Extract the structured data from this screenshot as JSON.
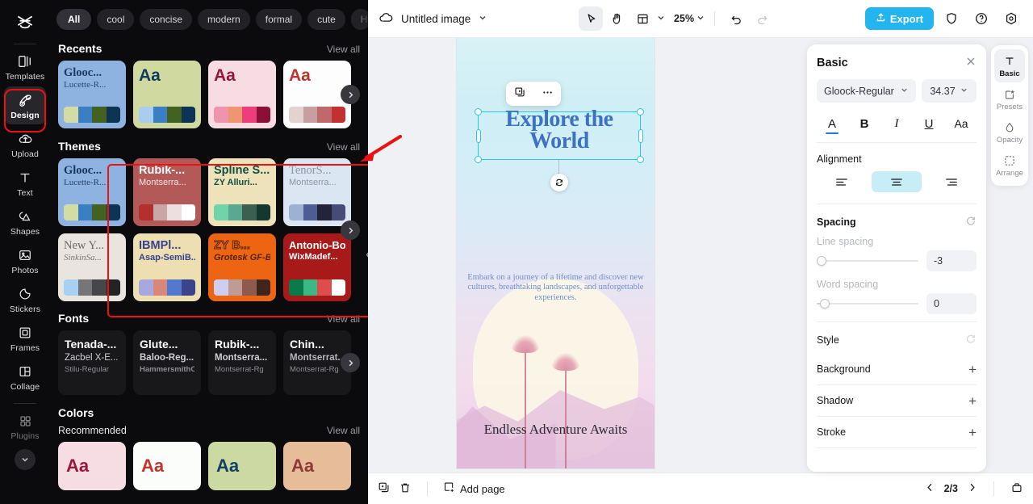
{
  "rail": {
    "logo_icon": "capcut-logo-icon",
    "items": [
      {
        "label": "Templates",
        "icon": "templates-icon",
        "active": false
      },
      {
        "label": "Design",
        "icon": "design-icon",
        "active": true
      },
      {
        "label": "Upload",
        "icon": "upload-cloud-icon",
        "active": false
      },
      {
        "label": "Text",
        "icon": "text-icon",
        "active": false
      },
      {
        "label": "Shapes",
        "icon": "shapes-icon",
        "active": false
      },
      {
        "label": "Photos",
        "icon": "photos-icon",
        "active": false
      },
      {
        "label": "Stickers",
        "icon": "stickers-icon",
        "active": false
      },
      {
        "label": "Frames",
        "icon": "frames-icon",
        "active": false
      },
      {
        "label": "Collage",
        "icon": "collage-icon",
        "active": false
      },
      {
        "label": "Plugins",
        "icon": "plugins-icon",
        "active": false
      }
    ],
    "expand_icon": "chevron-down-icon"
  },
  "panel": {
    "chips": [
      {
        "label": "All",
        "selected": true
      },
      {
        "label": "cool",
        "selected": false
      },
      {
        "label": "concise",
        "selected": false
      },
      {
        "label": "modern",
        "selected": false
      },
      {
        "label": "formal",
        "selected": false
      },
      {
        "label": "cute",
        "selected": false
      },
      {
        "label": "Holiday",
        "selected": false
      }
    ],
    "chip_more_icon": "chevron-down-icon",
    "view_all": "View all",
    "sections": {
      "recents": {
        "title": "Recents",
        "cards": [
          {
            "line1": "Glooc...",
            "line2": "Lucette-R...",
            "aa": "",
            "bg": "#8fb3e0",
            "c1": "#1d3a63",
            "c2": "#2a4a72",
            "swatch": [
              "#d4dba3",
              "#3a7fc4",
              "#44621f",
              "#0e3455"
            ]
          },
          {
            "line1": "",
            "line2": "",
            "aa": "Aa",
            "bg": "#cfd9a0",
            "c1": "#123a5c",
            "c2": "#123a5c",
            "swatch": [
              "#a9cdec",
              "#3a7fc4",
              "#44621f",
              "#0e3455"
            ]
          },
          {
            "line1": "",
            "line2": "",
            "aa": "Aa",
            "bg": "#f7dde3",
            "c1": "#9b1539",
            "c2": "#9b1539",
            "swatch": [
              "#f093ac",
              "#ee9571",
              "#ec3d7c",
              "#8c0f38"
            ]
          },
          {
            "line1": "",
            "line2": "",
            "aa": "Aa",
            "bg": "#fdfdfd",
            "c1": "#c0342f",
            "c2": "#c0342f",
            "swatch": [
              "#e4d2d1",
              "#c6a0a0",
              "#c0696a",
              "#c2302f"
            ]
          }
        ]
      },
      "themes": {
        "title": "Themes",
        "cards": [
          {
            "line1": "Glooc...",
            "line2": "Lucette-R...",
            "bg": "#8fb3e0",
            "c1": "#17365e",
            "c2": "#25446e",
            "swatch": [
              "#d4dba3",
              "#3a7fc4",
              "#44621f",
              "#0e3455"
            ]
          },
          {
            "line1": "Rubik-...",
            "line2": "Montserra...",
            "bg": "#b35a58",
            "c1": "#ffffff",
            "c2": "#f6e3e3",
            "swatch": [
              "#b4302f",
              "#c8a7a6",
              "#ecdfdf",
              "#ffffff"
            ]
          },
          {
            "line1": "Spline S...",
            "line2": "ZY Alluri...",
            "bg": "#eee2bb",
            "c1": "#10503c",
            "c2": "#10503c",
            "swatch": [
              "#72d3ab",
              "#59a890",
              "#3c5f52",
              "#13382f"
            ]
          },
          {
            "line1": "TenorS...",
            "line2": "Montserra...",
            "bg": "#dbe6f3",
            "c1": "#8e95a4",
            "c2": "#8e95a4",
            "swatch": [
              "#9db1d2",
              "#4e5d93",
              "#23243a",
              "#464c77"
            ]
          },
          {
            "line1": "New Y...",
            "line2": "SinkinSa...",
            "bg": "#e9e5de",
            "c1": "#6c6a68",
            "c2": "#7b7977",
            "swatch": [
              "#a7d0f2",
              "#767676",
              "#454749",
              "#232326"
            ]
          },
          {
            "line1": "IBMPl...",
            "line2": "Asap-SemiB...",
            "bg": "#eddfb1",
            "c1": "#36438c",
            "c2": "#36438c",
            "swatch": [
              "#a8a8de",
              "#d8877a",
              "#5379cf",
              "#3b448b"
            ]
          },
          {
            "line1": "ZY B...",
            "line2": "Grotesk GF-B...",
            "bg": "#ed6512",
            "c1": "#ed6512",
            "c2": "#54240e",
            "swatch": [
              "#cfcdf0",
              "#c09b94",
              "#8e5a4c",
              "#40251a"
            ]
          },
          {
            "line1": "Antonio-Bold",
            "line2": "WixMadef...",
            "bg": "#a81a1a",
            "c1": "#ffffff",
            "c2": "#ffffff",
            "swatch": [
              "#0b7a49",
              "#3bb883",
              "#de4c4c",
              "#ffffff"
            ]
          }
        ]
      },
      "fonts": {
        "title": "Fonts",
        "cards": [
          {
            "line1": "Tenada-...",
            "line2": "Zacbel X-E...",
            "line3": "Stilu-Regular"
          },
          {
            "line1": "Glute...",
            "line2": "Baloo-Reg...",
            "line3": "HammersmithOn..."
          },
          {
            "line1": "Rubik-...",
            "line2": "Montserra...",
            "line3": "Montserrat-Rg"
          },
          {
            "line1": "Chin...",
            "line2": "Montserrat...",
            "line3": "Montserrat-Rg"
          }
        ]
      },
      "colors": {
        "title": "Colors",
        "subtitle": "Recommended",
        "cards": [
          {
            "aa": "Aa",
            "bg": "#f5dde3",
            "fg": "#9a1840"
          },
          {
            "aa": "Aa",
            "bg": "#fbfdfb",
            "fg": "#c3342c"
          },
          {
            "aa": "Aa",
            "bg": "#cdd9a3",
            "fg": "#12415f"
          },
          {
            "aa": "Aa",
            "bg": "#e7bd99",
            "fg": "#8a3b38"
          }
        ]
      }
    },
    "next_arrow_icon": "chevron-right-icon",
    "collapse_icon": "chevron-left-icon"
  },
  "topbar": {
    "cloud_icon": "cloud-sync-icon",
    "doc_title": "Untitled image",
    "title_caret_icon": "chevron-down-icon",
    "tools": [
      {
        "name": "select-tool",
        "icon": "cursor-arrow-icon",
        "active": true
      },
      {
        "name": "hand-tool",
        "icon": "hand-icon",
        "active": false
      },
      {
        "name": "layout-tool",
        "icon": "layout-icon",
        "active": false
      }
    ],
    "layout_caret_icon": "chevron-down-icon",
    "zoom_value": "25%",
    "zoom_caret_icon": "chevron-down-icon",
    "undo_icon": "undo-icon",
    "redo_icon": "redo-icon",
    "export_label": "Export",
    "export_icon": "upload-icon",
    "export_color": "#22b5f0",
    "shield_icon": "shield-icon",
    "help_icon": "help-circle-icon",
    "settings_icon": "gear-icon"
  },
  "canvas": {
    "title_text": "Explore the World",
    "subtitle_text": "Embark on a journey of a lifetime and discover new cultures, breathtaking landscapes, and unforgettable experiences.",
    "footer_text": "Endless Adventure Awaits",
    "selection_color": "#25c8e8",
    "context_duplicate_icon": "duplicate-icon",
    "context_more_icon": "more-horizontal-icon",
    "rotate_icon": "rotate-icon"
  },
  "bottombar": {
    "duplicate_icon": "duplicate-page-icon",
    "delete_icon": "trash-icon",
    "add_page_label": "Add page",
    "add_page_icon": "add-page-icon",
    "prev_icon": "chevron-left-icon",
    "page_indicator": "2/3",
    "next_icon": "chevron-right-icon",
    "notes_icon": "notes-icon"
  },
  "props": {
    "title": "Basic",
    "close_icon": "close-icon",
    "font_family": "Gloock-Regular",
    "font_family_caret_icon": "chevron-down-icon",
    "font_size": "34.37",
    "font_size_caret_icon": "chevron-down-icon",
    "style_buttons": [
      {
        "label": "A",
        "name": "text-color-button",
        "underline": true
      },
      {
        "label": "B",
        "name": "bold-button",
        "underline": false
      },
      {
        "label": "I",
        "name": "italic-button",
        "underline": false
      },
      {
        "label": "U",
        "name": "underline-button",
        "underline": false
      },
      {
        "label": "Aa",
        "name": "letter-case-button",
        "underline": false
      }
    ],
    "alignment_label": "Alignment",
    "alignment": [
      {
        "name": "align-left-button",
        "active": false
      },
      {
        "name": "align-center-button",
        "active": true
      },
      {
        "name": "align-right-button",
        "active": false
      }
    ],
    "spacing_label": "Spacing",
    "spacing_reset_icon": "reset-icon",
    "line_spacing_label": "Line spacing",
    "line_spacing_value": "-3",
    "word_spacing_label": "Word spacing",
    "word_spacing_value": "0",
    "style_label": "Style",
    "style_reset_icon": "reset-icon",
    "style_rows": [
      {
        "label": "Background",
        "icon": "plus-icon"
      },
      {
        "label": "Shadow",
        "icon": "plus-icon"
      },
      {
        "label": "Stroke",
        "icon": "plus-icon"
      }
    ]
  },
  "right_tabs": [
    {
      "label": "Basic",
      "icon": "text-t-icon",
      "active": true
    },
    {
      "label": "Presets",
      "icon": "presets-icon",
      "active": false
    },
    {
      "label": "Opacity",
      "icon": "opacity-drop-icon",
      "active": false
    },
    {
      "label": "Arrange",
      "icon": "arrange-icon",
      "active": false
    }
  ],
  "annotation": {
    "arrow_color": "#ee1111",
    "highlight_color": "#ee1111"
  }
}
